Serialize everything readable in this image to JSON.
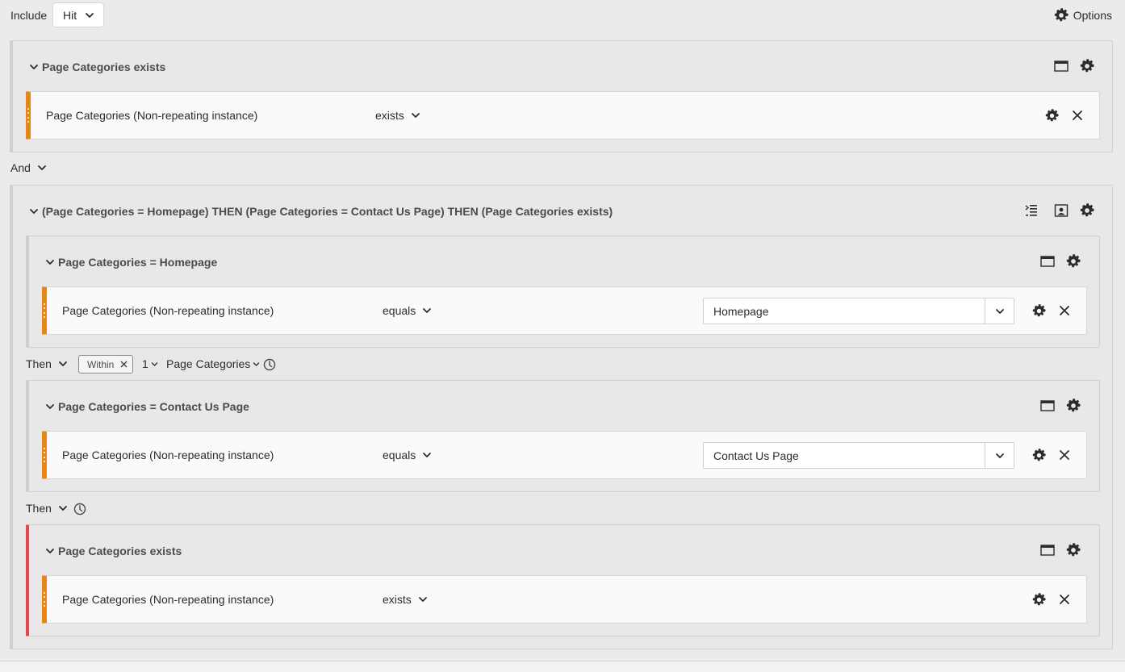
{
  "header": {
    "include_label": "Include",
    "hit_select_value": "Hit",
    "options_label": "Options"
  },
  "container1": {
    "title": "Page Categories exists",
    "rule": {
      "dimension": "Page Categories (Non-repeating instance)",
      "operator": "exists"
    }
  },
  "and_connector": {
    "label": "And"
  },
  "sequence": {
    "title": "(Page Categories = Homepage) THEN (Page Categories = Contact Us Page) THEN (Page Categories exists)",
    "step1": {
      "title": "Page Categories = Homepage",
      "rule": {
        "dimension": "Page Categories (Non-repeating instance)",
        "operator": "equals",
        "value": "Homepage"
      }
    },
    "then1": {
      "label": "Then",
      "within_label": "Within",
      "count_value": "1",
      "unit_value": "Page Categories"
    },
    "step2": {
      "title": "Page Categories = Contact Us Page",
      "rule": {
        "dimension": "Page Categories (Non-repeating instance)",
        "operator": "equals",
        "value": "Contact Us Page"
      }
    },
    "then2": {
      "label": "Then"
    },
    "step3": {
      "title": "Page Categories exists",
      "rule": {
        "dimension": "Page Categories (Non-repeating instance)",
        "operator": "exists"
      }
    }
  },
  "colors": {
    "rule_accent": "#e68619",
    "exclude_accent": "#e34850",
    "container_border": "#cfcfcf"
  },
  "icons": [
    "chevron-down-icon",
    "gear-icon",
    "close-icon",
    "container-view-icon",
    "sequence-list-icon",
    "exclude-icon",
    "clock-icon"
  ]
}
